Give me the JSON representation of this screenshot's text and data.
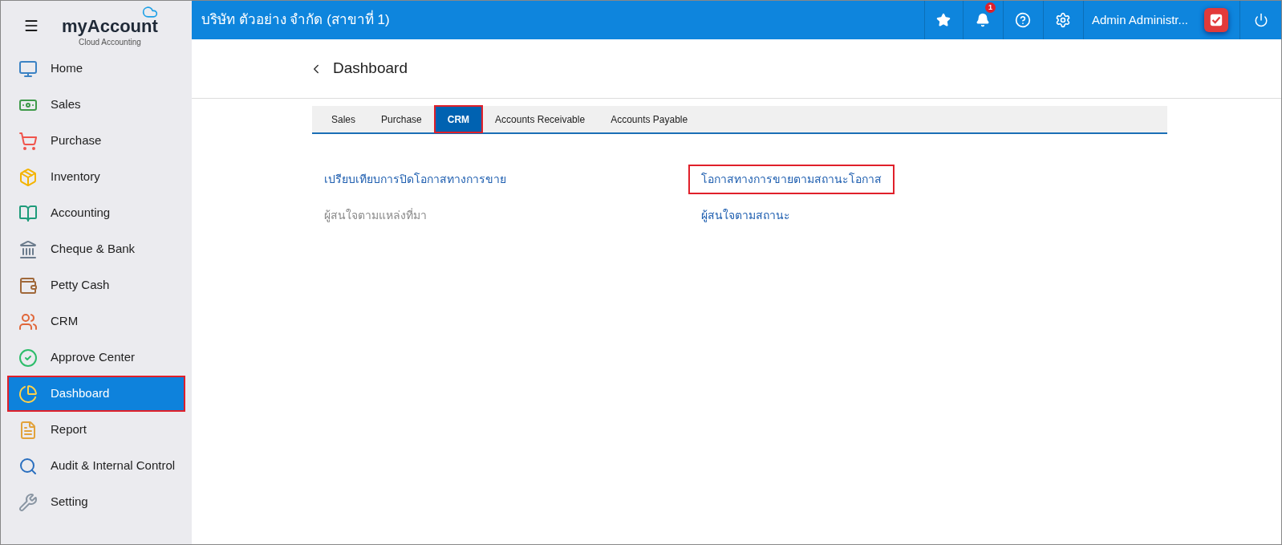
{
  "logo": {
    "brand": "myAccount",
    "tagline": "Cloud Accounting"
  },
  "sidebar": {
    "items": [
      {
        "label": "Home",
        "selected": false,
        "highlighted": false
      },
      {
        "label": "Sales",
        "selected": false,
        "highlighted": false
      },
      {
        "label": "Purchase",
        "selected": false,
        "highlighted": false
      },
      {
        "label": "Inventory",
        "selected": false,
        "highlighted": false
      },
      {
        "label": "Accounting",
        "selected": false,
        "highlighted": false
      },
      {
        "label": "Cheque & Bank",
        "selected": false,
        "highlighted": false
      },
      {
        "label": "Petty Cash",
        "selected": false,
        "highlighted": false
      },
      {
        "label": "CRM",
        "selected": false,
        "highlighted": false
      },
      {
        "label": "Approve Center",
        "selected": false,
        "highlighted": false
      },
      {
        "label": "Dashboard",
        "selected": true,
        "highlighted": true
      },
      {
        "label": "Report",
        "selected": false,
        "highlighted": false
      },
      {
        "label": "Audit & Internal Control",
        "selected": false,
        "highlighted": false
      },
      {
        "label": "Setting",
        "selected": false,
        "highlighted": false
      }
    ]
  },
  "header": {
    "company": "บริษัท ตัวอย่าง จำกัด (สาขาที่ 1)",
    "notification_count": "1",
    "user": "Admin Administr..."
  },
  "page": {
    "title": "Dashboard"
  },
  "tabs": [
    {
      "label": "Sales",
      "selected": false,
      "highlighted": false
    },
    {
      "label": "Purchase",
      "selected": false,
      "highlighted": false
    },
    {
      "label": "CRM",
      "selected": true,
      "highlighted": true
    },
    {
      "label": "Accounts Receivable",
      "selected": false,
      "highlighted": false
    },
    {
      "label": "Accounts Payable",
      "selected": false,
      "highlighted": false
    }
  ],
  "report_columns": [
    [
      {
        "label": "เปรียบเทียบการปิดโอกาสทางการขาย",
        "disabled": false,
        "highlighted": false
      },
      {
        "label": "ผู้สนใจตามแหล่งที่มา",
        "disabled": true,
        "highlighted": false
      }
    ],
    [
      {
        "label": "โอกาสทางการขายตามสถานะโอกาส",
        "disabled": false,
        "highlighted": true
      },
      {
        "label": "ผู้สนใจตามสถานะ",
        "disabled": false,
        "highlighted": false
      }
    ]
  ]
}
